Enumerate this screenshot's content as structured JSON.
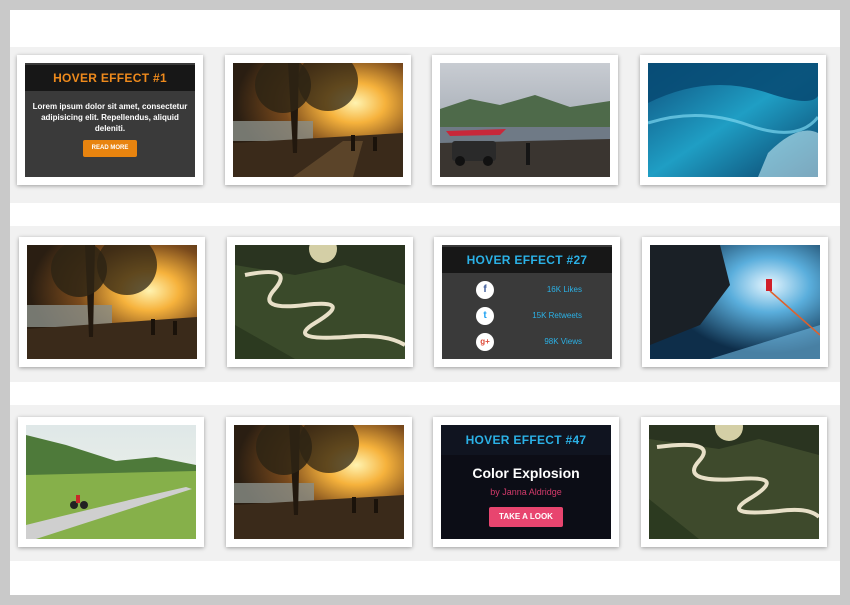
{
  "hover1": {
    "title": "HOVER EFFECT #1",
    "text": "Lorem ipsum dolor sit amet, consectetur adipisicing elit. Repellendus, aliquid deleniti.",
    "button": "READ MORE"
  },
  "hover27": {
    "title": "HOVER EFFECT #27",
    "facebook": {
      "icon": "facebook-icon",
      "value": "16K Likes"
    },
    "twitter": {
      "icon": "twitter-icon",
      "value": "15K Retweets"
    },
    "google": {
      "icon": "google-plus-icon",
      "value": "98K Views"
    }
  },
  "hover47": {
    "title": "HOVER EFFECT #47",
    "headline": "Color Explosion",
    "byline": "by Janna Aldridge",
    "button": "TAKE A LOOK"
  },
  "colors": {
    "orange_accent": "#ee8a1c",
    "blue_accent": "#2bb1e6",
    "pink_accent": "#e8456f",
    "facebook": "#3b5998",
    "twitter": "#1da1f2",
    "google": "#dd4b39"
  }
}
